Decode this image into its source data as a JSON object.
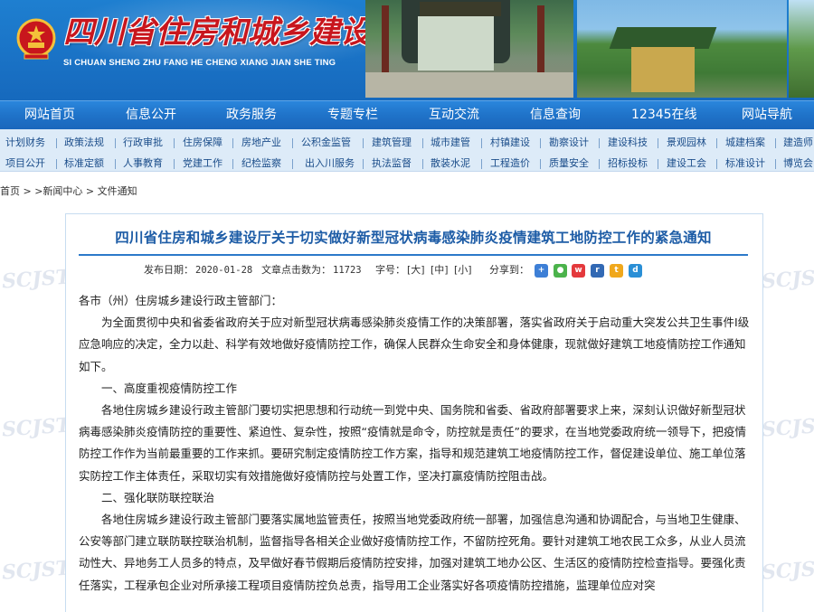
{
  "header": {
    "title_cn": "四川省住房和城乡建设厅",
    "title_en": "SI CHUAN SHENG ZHU FANG HE CHENG XIANG JIAN SHE TING",
    "emblem_icon": "national-emblem-icon",
    "bg_color": "#1a73c6",
    "title_color": "#c8161d"
  },
  "main_nav": {
    "items": [
      "网站首页",
      "信息公开",
      "政务服务",
      "专题专栏",
      "互动交流",
      "信息查询",
      "12345在线",
      "网站导航"
    ]
  },
  "sub_nav": {
    "row1": [
      "计划财务",
      "政策法规",
      "行政审批",
      "住房保障",
      "房地产业",
      "公积金监管",
      "建筑管理",
      "城市建管",
      "村镇建设",
      "勘察设计",
      "建设科技",
      "景观园林",
      "城建档案",
      "建造师"
    ],
    "row2": [
      "项目公开",
      "标准定额",
      "人事教育",
      "党建工作",
      "纪检监察",
      "出入川服务",
      "执法监督",
      "散装水泥",
      "工程造价",
      "质量安全",
      "招标投标",
      "建设工会",
      "标准设计",
      "博览会"
    ]
  },
  "breadcrumb": {
    "home": "首页",
    "sep1": " > >",
    "news": "新闻中心",
    "sep2": " > ",
    "current": "文件通知"
  },
  "article": {
    "title": "四川省住房和城乡建设厅关于切实做好新型冠状病毒感染肺炎疫情建筑工地防控工作的紧急通知",
    "publish_label": "发布日期：",
    "publish_date": "2020-01-28",
    "clicks_label": "文章点击数为：",
    "clicks": "11723",
    "font_label": "字号：",
    "font_large": "[大]",
    "font_medium": "[中]",
    "font_small": "[小]",
    "share_label": "分享到：",
    "share_icons": [
      "qzone-icon",
      "wechat-icon",
      "weibo-icon",
      "renren-icon",
      "tencent-weibo-icon",
      "douban-icon"
    ],
    "salutation": "各市（州）住房城乡建设行政主管部门：",
    "intro": "为全面贯彻中央和省委省政府关于应对新型冠状病毒感染肺炎疫情工作的决策部署，落实省政府关于启动重大突发公共卫生事件Ⅰ级应急响应的决定，全力以赴、科学有效地做好疫情防控工作，确保人民群众生命安全和身体健康，现就做好建筑工地疫情防控工作通知如下。",
    "section1_title": "一、高度重视疫情防控工作",
    "section1_body": "各地住房城乡建设行政主管部门要切实把思想和行动统一到党中央、国务院和省委、省政府部署要求上来，深刻认识做好新型冠状病毒感染肺炎疫情防控的重要性、紧迫性、复杂性，按照“疫情就是命令，防控就是责任”的要求，在当地党委政府统一领导下，把疫情防控工作作为当前最重要的工作来抓。要研究制定疫情防控工作方案，指导和规范建筑工地疫情防控工作，督促建设单位、施工单位落实防控工作主体责任，采取切实有效措施做好疫情防控与处置工作，坚决打赢疫情防控阻击战。",
    "section2_title": "二、强化联防联控联治",
    "section2_body": "各地住房城乡建设行政主管部门要落实属地监管责任，按照当地党委政府统一部署，加强信息沟通和协调配合，与当地卫生健康、公安等部门建立联防联控联治机制，监督指导各相关企业做好疫情防控工作，不留防控死角。要针对建筑工地农民工众多，从业人员流动性大、异地务工人员多的特点，及早做好春节假期后疫情防控安排，加强对建筑工地办公区、生活区的疫情防控检查指导。要强化责任落实，工程承包企业对所承接工程项目疫情防控负总责，指导用工企业落实好各项疫情防控措施，监理单位应对突"
  },
  "watermark": "SCJST"
}
